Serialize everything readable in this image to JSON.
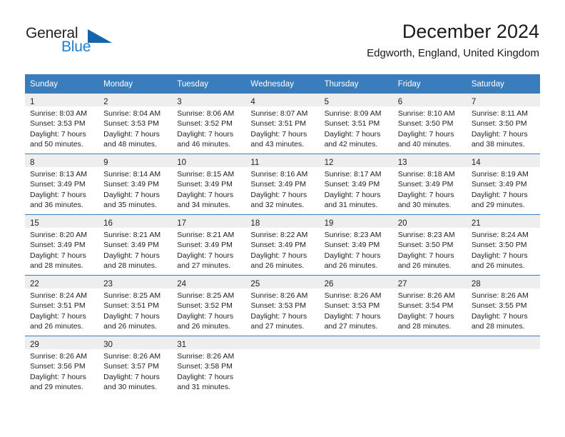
{
  "brand": {
    "name_part1": "General",
    "name_part2": "Blue",
    "logo_icon": "triangle-icon",
    "accent_color": "#1a7fd4"
  },
  "header": {
    "title": "December 2024",
    "subtitle": "Edgworth, England, United Kingdom"
  },
  "theme": {
    "header_bg": "#3a7dbd",
    "header_text": "#ffffff",
    "daynum_band_bg": "#eeeeee",
    "row_divider": "#3a7dbd"
  },
  "weekdays": [
    "Sunday",
    "Monday",
    "Tuesday",
    "Wednesday",
    "Thursday",
    "Friday",
    "Saturday"
  ],
  "weeks": [
    [
      {
        "day": "1",
        "sunrise": "Sunrise: 8:03 AM",
        "sunset": "Sunset: 3:53 PM",
        "daylight_1": "Daylight: 7 hours",
        "daylight_2": "and 50 minutes."
      },
      {
        "day": "2",
        "sunrise": "Sunrise: 8:04 AM",
        "sunset": "Sunset: 3:53 PM",
        "daylight_1": "Daylight: 7 hours",
        "daylight_2": "and 48 minutes."
      },
      {
        "day": "3",
        "sunrise": "Sunrise: 8:06 AM",
        "sunset": "Sunset: 3:52 PM",
        "daylight_1": "Daylight: 7 hours",
        "daylight_2": "and 46 minutes."
      },
      {
        "day": "4",
        "sunrise": "Sunrise: 8:07 AM",
        "sunset": "Sunset: 3:51 PM",
        "daylight_1": "Daylight: 7 hours",
        "daylight_2": "and 43 minutes."
      },
      {
        "day": "5",
        "sunrise": "Sunrise: 8:09 AM",
        "sunset": "Sunset: 3:51 PM",
        "daylight_1": "Daylight: 7 hours",
        "daylight_2": "and 42 minutes."
      },
      {
        "day": "6",
        "sunrise": "Sunrise: 8:10 AM",
        "sunset": "Sunset: 3:50 PM",
        "daylight_1": "Daylight: 7 hours",
        "daylight_2": "and 40 minutes."
      },
      {
        "day": "7",
        "sunrise": "Sunrise: 8:11 AM",
        "sunset": "Sunset: 3:50 PM",
        "daylight_1": "Daylight: 7 hours",
        "daylight_2": "and 38 minutes."
      }
    ],
    [
      {
        "day": "8",
        "sunrise": "Sunrise: 8:13 AM",
        "sunset": "Sunset: 3:49 PM",
        "daylight_1": "Daylight: 7 hours",
        "daylight_2": "and 36 minutes."
      },
      {
        "day": "9",
        "sunrise": "Sunrise: 8:14 AM",
        "sunset": "Sunset: 3:49 PM",
        "daylight_1": "Daylight: 7 hours",
        "daylight_2": "and 35 minutes."
      },
      {
        "day": "10",
        "sunrise": "Sunrise: 8:15 AM",
        "sunset": "Sunset: 3:49 PM",
        "daylight_1": "Daylight: 7 hours",
        "daylight_2": "and 34 minutes."
      },
      {
        "day": "11",
        "sunrise": "Sunrise: 8:16 AM",
        "sunset": "Sunset: 3:49 PM",
        "daylight_1": "Daylight: 7 hours",
        "daylight_2": "and 32 minutes."
      },
      {
        "day": "12",
        "sunrise": "Sunrise: 8:17 AM",
        "sunset": "Sunset: 3:49 PM",
        "daylight_1": "Daylight: 7 hours",
        "daylight_2": "and 31 minutes."
      },
      {
        "day": "13",
        "sunrise": "Sunrise: 8:18 AM",
        "sunset": "Sunset: 3:49 PM",
        "daylight_1": "Daylight: 7 hours",
        "daylight_2": "and 30 minutes."
      },
      {
        "day": "14",
        "sunrise": "Sunrise: 8:19 AM",
        "sunset": "Sunset: 3:49 PM",
        "daylight_1": "Daylight: 7 hours",
        "daylight_2": "and 29 minutes."
      }
    ],
    [
      {
        "day": "15",
        "sunrise": "Sunrise: 8:20 AM",
        "sunset": "Sunset: 3:49 PM",
        "daylight_1": "Daylight: 7 hours",
        "daylight_2": "and 28 minutes."
      },
      {
        "day": "16",
        "sunrise": "Sunrise: 8:21 AM",
        "sunset": "Sunset: 3:49 PM",
        "daylight_1": "Daylight: 7 hours",
        "daylight_2": "and 28 minutes."
      },
      {
        "day": "17",
        "sunrise": "Sunrise: 8:21 AM",
        "sunset": "Sunset: 3:49 PM",
        "daylight_1": "Daylight: 7 hours",
        "daylight_2": "and 27 minutes."
      },
      {
        "day": "18",
        "sunrise": "Sunrise: 8:22 AM",
        "sunset": "Sunset: 3:49 PM",
        "daylight_1": "Daylight: 7 hours",
        "daylight_2": "and 26 minutes."
      },
      {
        "day": "19",
        "sunrise": "Sunrise: 8:23 AM",
        "sunset": "Sunset: 3:49 PM",
        "daylight_1": "Daylight: 7 hours",
        "daylight_2": "and 26 minutes."
      },
      {
        "day": "20",
        "sunrise": "Sunrise: 8:23 AM",
        "sunset": "Sunset: 3:50 PM",
        "daylight_1": "Daylight: 7 hours",
        "daylight_2": "and 26 minutes."
      },
      {
        "day": "21",
        "sunrise": "Sunrise: 8:24 AM",
        "sunset": "Sunset: 3:50 PM",
        "daylight_1": "Daylight: 7 hours",
        "daylight_2": "and 26 minutes."
      }
    ],
    [
      {
        "day": "22",
        "sunrise": "Sunrise: 8:24 AM",
        "sunset": "Sunset: 3:51 PM",
        "daylight_1": "Daylight: 7 hours",
        "daylight_2": "and 26 minutes."
      },
      {
        "day": "23",
        "sunrise": "Sunrise: 8:25 AM",
        "sunset": "Sunset: 3:51 PM",
        "daylight_1": "Daylight: 7 hours",
        "daylight_2": "and 26 minutes."
      },
      {
        "day": "24",
        "sunrise": "Sunrise: 8:25 AM",
        "sunset": "Sunset: 3:52 PM",
        "daylight_1": "Daylight: 7 hours",
        "daylight_2": "and 26 minutes."
      },
      {
        "day": "25",
        "sunrise": "Sunrise: 8:26 AM",
        "sunset": "Sunset: 3:53 PM",
        "daylight_1": "Daylight: 7 hours",
        "daylight_2": "and 27 minutes."
      },
      {
        "day": "26",
        "sunrise": "Sunrise: 8:26 AM",
        "sunset": "Sunset: 3:53 PM",
        "daylight_1": "Daylight: 7 hours",
        "daylight_2": "and 27 minutes."
      },
      {
        "day": "27",
        "sunrise": "Sunrise: 8:26 AM",
        "sunset": "Sunset: 3:54 PM",
        "daylight_1": "Daylight: 7 hours",
        "daylight_2": "and 28 minutes."
      },
      {
        "day": "28",
        "sunrise": "Sunrise: 8:26 AM",
        "sunset": "Sunset: 3:55 PM",
        "daylight_1": "Daylight: 7 hours",
        "daylight_2": "and 28 minutes."
      }
    ],
    [
      {
        "day": "29",
        "sunrise": "Sunrise: 8:26 AM",
        "sunset": "Sunset: 3:56 PM",
        "daylight_1": "Daylight: 7 hours",
        "daylight_2": "and 29 minutes."
      },
      {
        "day": "30",
        "sunrise": "Sunrise: 8:26 AM",
        "sunset": "Sunset: 3:57 PM",
        "daylight_1": "Daylight: 7 hours",
        "daylight_2": "and 30 minutes."
      },
      {
        "day": "31",
        "sunrise": "Sunrise: 8:26 AM",
        "sunset": "Sunset: 3:58 PM",
        "daylight_1": "Daylight: 7 hours",
        "daylight_2": "and 31 minutes."
      },
      {
        "day": "",
        "sunrise": "",
        "sunset": "",
        "daylight_1": "",
        "daylight_2": ""
      },
      {
        "day": "",
        "sunrise": "",
        "sunset": "",
        "daylight_1": "",
        "daylight_2": ""
      },
      {
        "day": "",
        "sunrise": "",
        "sunset": "",
        "daylight_1": "",
        "daylight_2": ""
      },
      {
        "day": "",
        "sunrise": "",
        "sunset": "",
        "daylight_1": "",
        "daylight_2": ""
      }
    ]
  ]
}
